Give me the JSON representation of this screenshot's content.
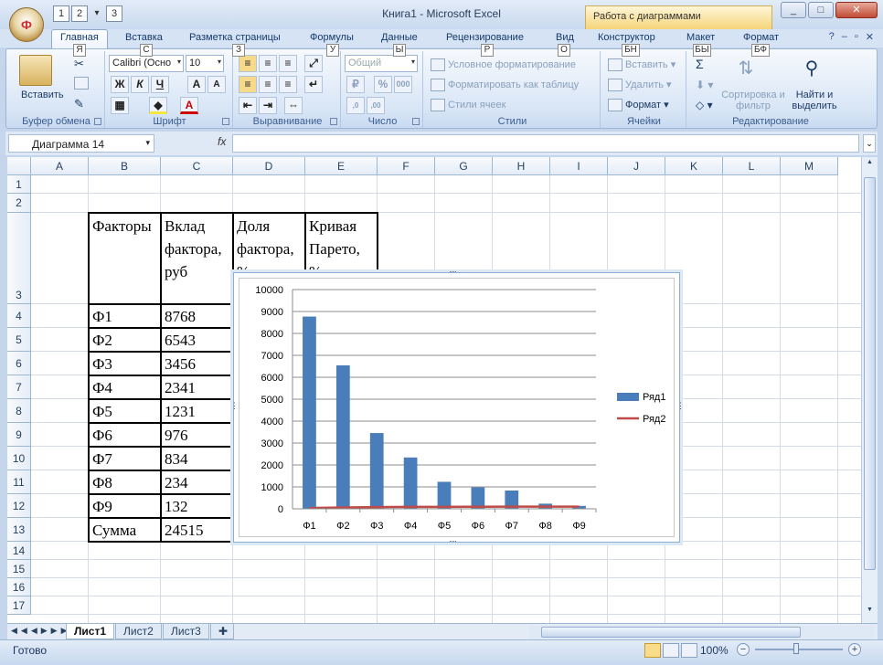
{
  "window": {
    "title": "Книга1 - Microsoft Excel",
    "context_tab": "Работа с диаграммами",
    "buttons": [
      "_",
      "□",
      "✕"
    ]
  },
  "qat": {
    "keys": [
      "1",
      "2",
      "3"
    ]
  },
  "office_button": {
    "keytip": "Ф"
  },
  "tabs": [
    {
      "label": "Главная",
      "keytip": "Я"
    },
    {
      "label": "Вставка",
      "keytip": "С"
    },
    {
      "label": "Разметка страницы",
      "keytip": "З"
    },
    {
      "label": "Формулы",
      "keytip": "У"
    },
    {
      "label": "Данные",
      "keytip": "Ы"
    },
    {
      "label": "Рецензирование",
      "keytip": "Р"
    },
    {
      "label": "Вид",
      "keytip": "О"
    },
    {
      "label": "Конструктор",
      "keytip": "БН"
    },
    {
      "label": "Макет",
      "keytip": "БЫ"
    },
    {
      "label": "Формат",
      "keytip": "БФ"
    }
  ],
  "ribbon": {
    "clipboard": {
      "label": "Буфер обмена",
      "paste": "Вставить"
    },
    "font": {
      "label": "Шрифт",
      "font_name": "Calibri (Осно",
      "font_size": "10",
      "bold": "Ж",
      "italic": "К",
      "underline": "Ч",
      "grow": "A",
      "shrink": "A"
    },
    "alignment": {
      "label": "Выравнивание"
    },
    "number": {
      "label": "Число",
      "format": "Общий",
      "percent": "%",
      "thousands": "000"
    },
    "styles": {
      "label": "Стили",
      "conditional": "Условное форматирование",
      "table": "Форматировать как таблицу",
      "cell_styles": "Стили ячеек"
    },
    "cells": {
      "label": "Ячейки",
      "insert": "Вставить",
      "delete": "Удалить",
      "format": "Формат"
    },
    "editing": {
      "label": "Редактирование",
      "sort": "Сортировка и фильтр",
      "find": "Найти и выделить",
      "sigma": "Σ"
    }
  },
  "formula_bar": {
    "name_box": "Диаграмма 14",
    "fx": "fx",
    "content": ""
  },
  "columns": [
    "A",
    "B",
    "C",
    "D",
    "E",
    "F",
    "G",
    "H",
    "I",
    "J",
    "K",
    "L",
    "M"
  ],
  "rows": [
    "1",
    "2",
    "3",
    "4",
    "5",
    "6",
    "7",
    "8",
    "9",
    "10",
    "11",
    "12",
    "13",
    "14",
    "15",
    "16",
    "17"
  ],
  "table": {
    "headers": [
      "Факторы",
      "Вклад фактора, руб",
      "Доля фактора, %",
      "Кривая Парето, %"
    ],
    "header_lines": [
      [
        "Факторы"
      ],
      [
        "Вклад",
        "фактора,",
        "руб"
      ],
      [
        "Доля",
        "фактора,",
        "%"
      ],
      [
        "Кривая",
        "Парето,",
        "%"
      ]
    ],
    "rows": [
      [
        "Ф1",
        "8768"
      ],
      [
        "Ф2",
        "6543"
      ],
      [
        "Ф3",
        "3456"
      ],
      [
        "Ф4",
        "2341"
      ],
      [
        "Ф5",
        "1231"
      ],
      [
        "Ф6",
        "976"
      ],
      [
        "Ф7",
        "834"
      ],
      [
        "Ф8",
        "234"
      ],
      [
        "Ф9",
        "132"
      ],
      [
        "Сумма",
        "24515"
      ]
    ]
  },
  "chart_data": {
    "type": "bar",
    "categories": [
      "Ф1",
      "Ф2",
      "Ф3",
      "Ф4",
      "Ф5",
      "Ф6",
      "Ф7",
      "Ф8",
      "Ф9"
    ],
    "series": [
      {
        "name": "Ряд1",
        "type": "bar",
        "color": "#4a7ebb",
        "values": [
          8768,
          6543,
          3456,
          2341,
          1231,
          976,
          834,
          234,
          132
        ]
      },
      {
        "name": "Ряд2",
        "type": "line",
        "color": "#be4b48",
        "values": [
          36,
          62,
          76,
          86,
          91,
          95,
          98,
          99,
          100
        ]
      }
    ],
    "ylim": [
      0,
      10000
    ],
    "yticks": [
      0,
      1000,
      2000,
      3000,
      4000,
      5000,
      6000,
      7000,
      8000,
      9000,
      10000
    ],
    "grid": true,
    "legend": "right"
  },
  "sheets": [
    "Лист1",
    "Лист2",
    "Лист3"
  ],
  "status": {
    "text": "Готово",
    "zoom": "100%"
  }
}
